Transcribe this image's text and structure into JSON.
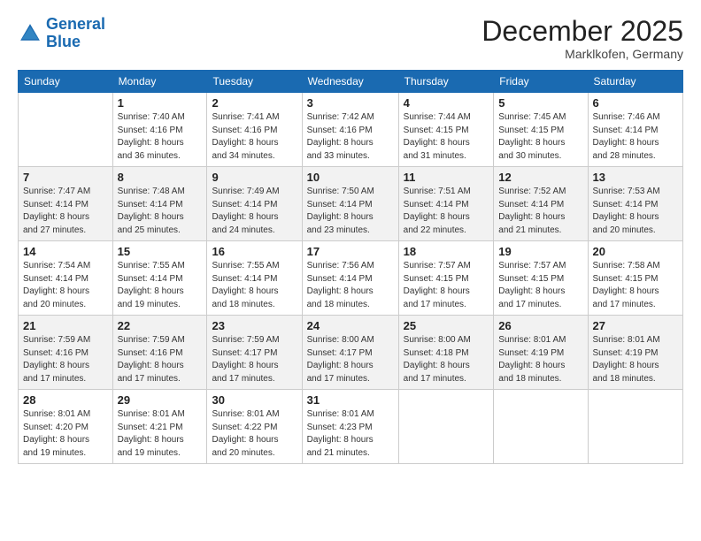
{
  "logo": {
    "line1": "General",
    "line2": "Blue"
  },
  "header": {
    "title": "December 2025",
    "subtitle": "Marklkofen, Germany"
  },
  "columns": [
    "Sunday",
    "Monday",
    "Tuesday",
    "Wednesday",
    "Thursday",
    "Friday",
    "Saturday"
  ],
  "weeks": [
    [
      {
        "day": "",
        "info": ""
      },
      {
        "day": "1",
        "info": "Sunrise: 7:40 AM\nSunset: 4:16 PM\nDaylight: 8 hours\nand 36 minutes."
      },
      {
        "day": "2",
        "info": "Sunrise: 7:41 AM\nSunset: 4:16 PM\nDaylight: 8 hours\nand 34 minutes."
      },
      {
        "day": "3",
        "info": "Sunrise: 7:42 AM\nSunset: 4:16 PM\nDaylight: 8 hours\nand 33 minutes."
      },
      {
        "day": "4",
        "info": "Sunrise: 7:44 AM\nSunset: 4:15 PM\nDaylight: 8 hours\nand 31 minutes."
      },
      {
        "day": "5",
        "info": "Sunrise: 7:45 AM\nSunset: 4:15 PM\nDaylight: 8 hours\nand 30 minutes."
      },
      {
        "day": "6",
        "info": "Sunrise: 7:46 AM\nSunset: 4:14 PM\nDaylight: 8 hours\nand 28 minutes."
      }
    ],
    [
      {
        "day": "7",
        "info": "Sunrise: 7:47 AM\nSunset: 4:14 PM\nDaylight: 8 hours\nand 27 minutes."
      },
      {
        "day": "8",
        "info": "Sunrise: 7:48 AM\nSunset: 4:14 PM\nDaylight: 8 hours\nand 25 minutes."
      },
      {
        "day": "9",
        "info": "Sunrise: 7:49 AM\nSunset: 4:14 PM\nDaylight: 8 hours\nand 24 minutes."
      },
      {
        "day": "10",
        "info": "Sunrise: 7:50 AM\nSunset: 4:14 PM\nDaylight: 8 hours\nand 23 minutes."
      },
      {
        "day": "11",
        "info": "Sunrise: 7:51 AM\nSunset: 4:14 PM\nDaylight: 8 hours\nand 22 minutes."
      },
      {
        "day": "12",
        "info": "Sunrise: 7:52 AM\nSunset: 4:14 PM\nDaylight: 8 hours\nand 21 minutes."
      },
      {
        "day": "13",
        "info": "Sunrise: 7:53 AM\nSunset: 4:14 PM\nDaylight: 8 hours\nand 20 minutes."
      }
    ],
    [
      {
        "day": "14",
        "info": "Sunrise: 7:54 AM\nSunset: 4:14 PM\nDaylight: 8 hours\nand 20 minutes."
      },
      {
        "day": "15",
        "info": "Sunrise: 7:55 AM\nSunset: 4:14 PM\nDaylight: 8 hours\nand 19 minutes."
      },
      {
        "day": "16",
        "info": "Sunrise: 7:55 AM\nSunset: 4:14 PM\nDaylight: 8 hours\nand 18 minutes."
      },
      {
        "day": "17",
        "info": "Sunrise: 7:56 AM\nSunset: 4:14 PM\nDaylight: 8 hours\nand 18 minutes."
      },
      {
        "day": "18",
        "info": "Sunrise: 7:57 AM\nSunset: 4:15 PM\nDaylight: 8 hours\nand 17 minutes."
      },
      {
        "day": "19",
        "info": "Sunrise: 7:57 AM\nSunset: 4:15 PM\nDaylight: 8 hours\nand 17 minutes."
      },
      {
        "day": "20",
        "info": "Sunrise: 7:58 AM\nSunset: 4:15 PM\nDaylight: 8 hours\nand 17 minutes."
      }
    ],
    [
      {
        "day": "21",
        "info": "Sunrise: 7:59 AM\nSunset: 4:16 PM\nDaylight: 8 hours\nand 17 minutes."
      },
      {
        "day": "22",
        "info": "Sunrise: 7:59 AM\nSunset: 4:16 PM\nDaylight: 8 hours\nand 17 minutes."
      },
      {
        "day": "23",
        "info": "Sunrise: 7:59 AM\nSunset: 4:17 PM\nDaylight: 8 hours\nand 17 minutes."
      },
      {
        "day": "24",
        "info": "Sunrise: 8:00 AM\nSunset: 4:17 PM\nDaylight: 8 hours\nand 17 minutes."
      },
      {
        "day": "25",
        "info": "Sunrise: 8:00 AM\nSunset: 4:18 PM\nDaylight: 8 hours\nand 17 minutes."
      },
      {
        "day": "26",
        "info": "Sunrise: 8:01 AM\nSunset: 4:19 PM\nDaylight: 8 hours\nand 18 minutes."
      },
      {
        "day": "27",
        "info": "Sunrise: 8:01 AM\nSunset: 4:19 PM\nDaylight: 8 hours\nand 18 minutes."
      }
    ],
    [
      {
        "day": "28",
        "info": "Sunrise: 8:01 AM\nSunset: 4:20 PM\nDaylight: 8 hours\nand 19 minutes."
      },
      {
        "day": "29",
        "info": "Sunrise: 8:01 AM\nSunset: 4:21 PM\nDaylight: 8 hours\nand 19 minutes."
      },
      {
        "day": "30",
        "info": "Sunrise: 8:01 AM\nSunset: 4:22 PM\nDaylight: 8 hours\nand 20 minutes."
      },
      {
        "day": "31",
        "info": "Sunrise: 8:01 AM\nSunset: 4:23 PM\nDaylight: 8 hours\nand 21 minutes."
      },
      {
        "day": "",
        "info": ""
      },
      {
        "day": "",
        "info": ""
      },
      {
        "day": "",
        "info": ""
      }
    ]
  ]
}
